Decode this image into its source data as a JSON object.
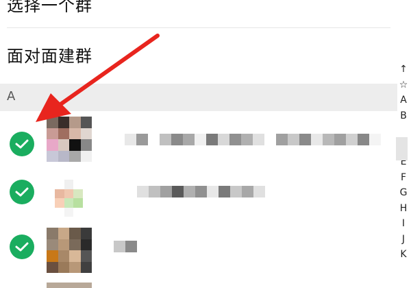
{
  "menu": {
    "select_group": "选择一个群",
    "face_to_face": "面对面建群"
  },
  "section": {
    "letter": "A"
  },
  "contacts": [
    {
      "selected": true
    },
    {
      "selected": true
    },
    {
      "selected": true
    }
  ],
  "index": [
    "↑",
    "☆",
    "A",
    "B",
    "",
    "",
    "E",
    "F",
    "G",
    "H",
    "I",
    "J",
    "K"
  ],
  "colors": {
    "check_green": "#1aad5f",
    "arrow_red": "#e8251e",
    "section_bg": "#ededed"
  }
}
